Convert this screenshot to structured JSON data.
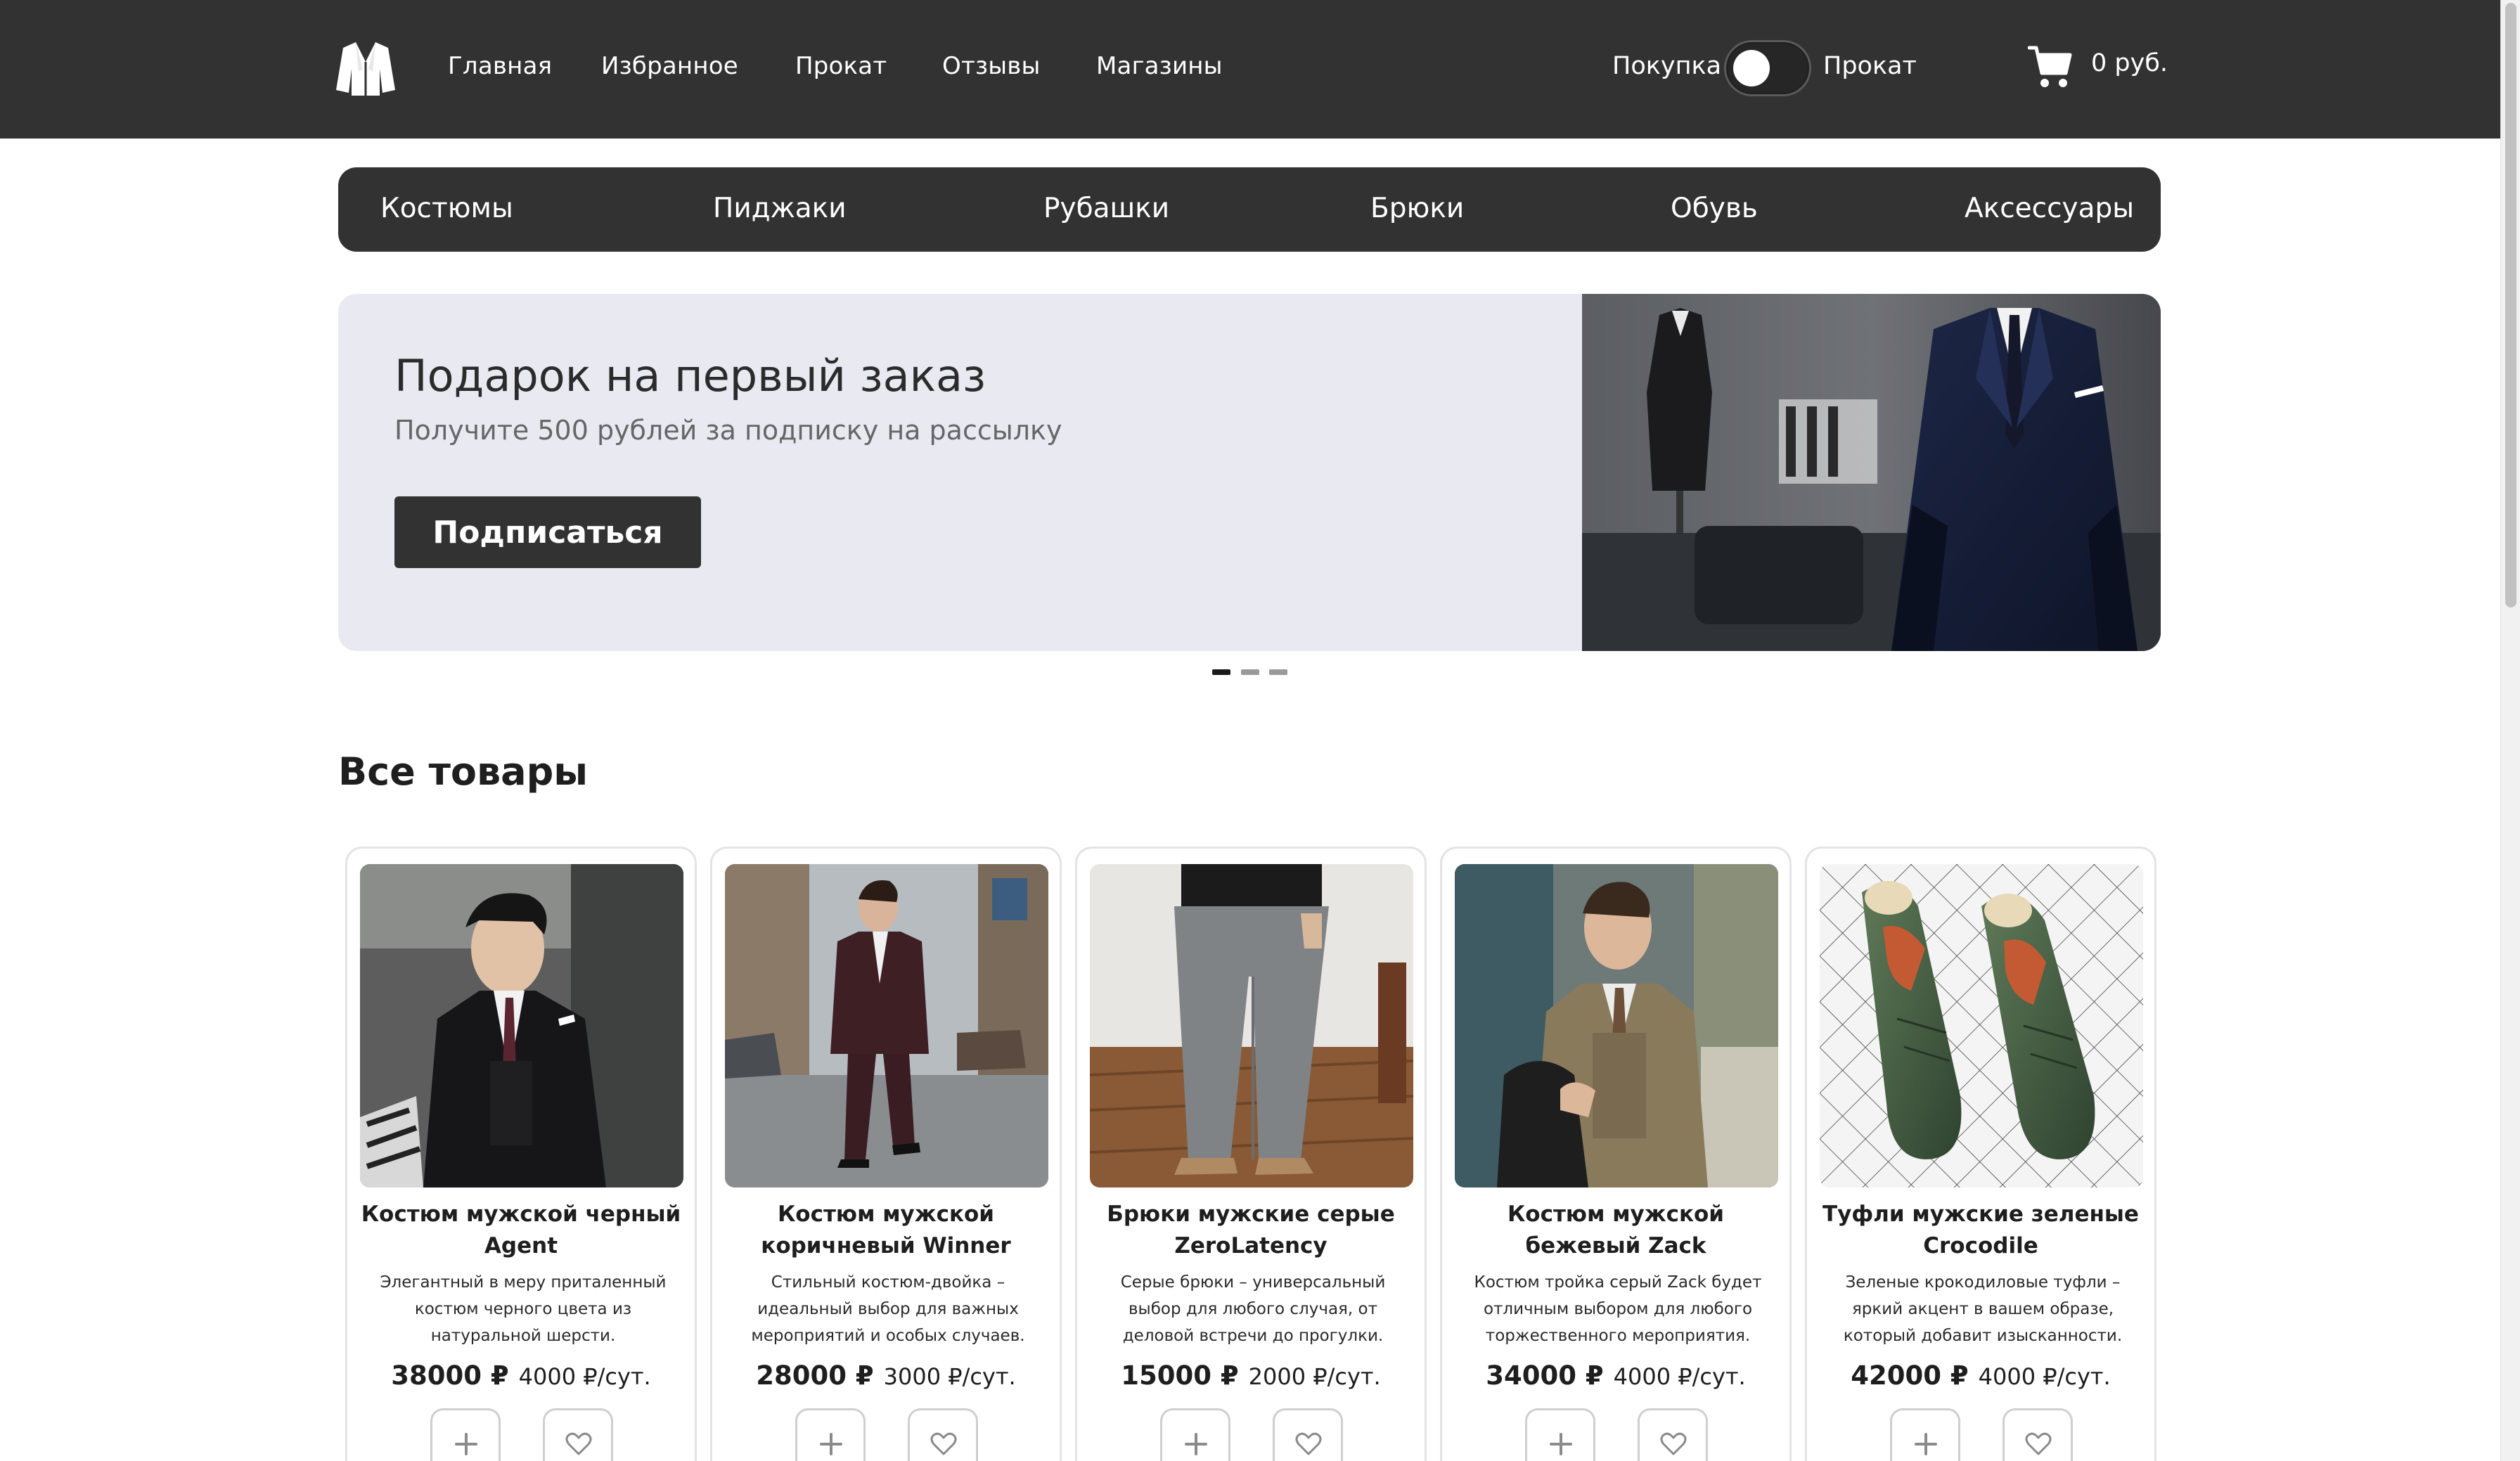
{
  "header": {
    "logo_icon": "jacket-logo-icon",
    "nav": [
      "Главная",
      "Избранное",
      "Прокат",
      "Отзывы",
      "Магазины"
    ],
    "mode_left": "Покупка",
    "mode_right": "Прокат",
    "mode_toggle_state": "Покупка",
    "cart_icon": "cart-icon",
    "cart_total": "0 руб."
  },
  "categories": [
    "Костюмы",
    "Пиджаки",
    "Рубашки",
    "Брюки",
    "Обувь",
    "Аксессуары"
  ],
  "banner": {
    "title": "Подарок на первый заказ",
    "subtitle": "Получите 500 рублей за подписку на рассылку",
    "button": "Подписаться",
    "slides_count": 3,
    "active_slide": 1
  },
  "products_section": {
    "title": "Все товары",
    "items": [
      {
        "name": "Костюм мужской черный Agent",
        "description": "Элегантный в меру приталенный костюм черного цвета из натуральной шерсти.",
        "price": "38000 ₽",
        "rent": "4000 ₽/сут."
      },
      {
        "name": "Костюм мужской коричневый Winner",
        "description": "Стильный костюм-двойка – идеальный выбор для важных мероприятий и особых случаев.",
        "price": "28000 ₽",
        "rent": "3000 ₽/сут."
      },
      {
        "name": "Брюки мужские серые ZeroLatency",
        "description": "Серые брюки – универсальный выбор для любого случая, от деловой встречи до прогулки.",
        "price": "15000 ₽",
        "rent": "2000 ₽/сут."
      },
      {
        "name": "Костюм мужской бежевый Zack",
        "description": "Костюм тройка серый Zack будет отличным выбором для любого торжественного мероприятия.",
        "price": "34000 ₽",
        "rent": "4000 ₽/сут."
      },
      {
        "name": "Туфли мужские зеленые Crocodile",
        "description": "Зеленые крокодиловые туфли – яркий акцент в вашем образе, который добавит изысканности.",
        "price": "42000 ₽",
        "rent": "4000 ₽/сут."
      }
    ],
    "add_icon": "plus-icon",
    "fav_icon": "heart-icon"
  },
  "colors": {
    "header_bg": "#323232",
    "banner_bg": "#e9e9f1",
    "accent_dark": "#323232"
  }
}
